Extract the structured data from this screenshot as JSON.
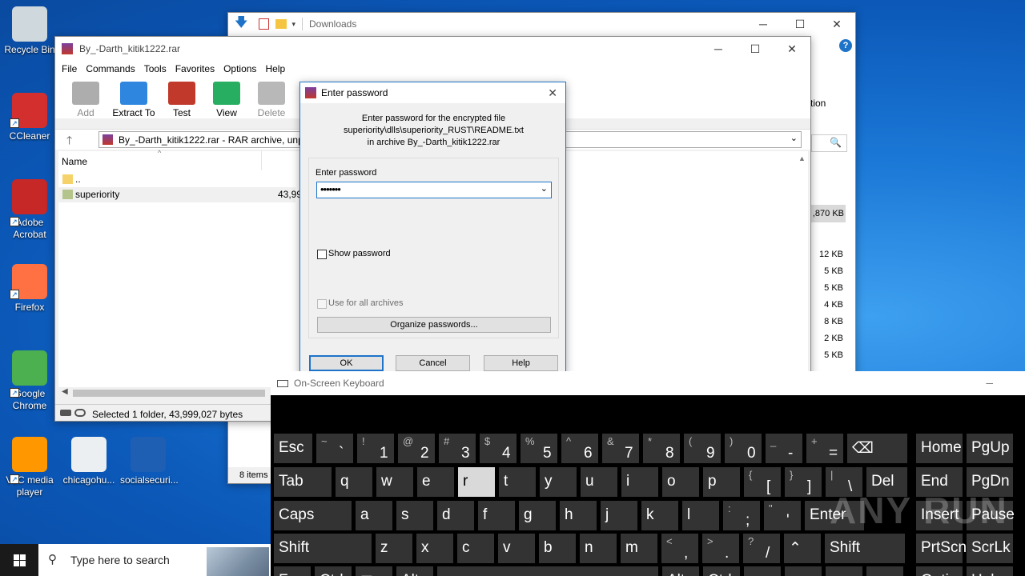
{
  "desktop": {
    "icons": [
      {
        "label": "Recycle Bin",
        "color": "#cfd8dc"
      },
      {
        "label": "CCleaner",
        "color": "#d32f2f"
      },
      {
        "label": "Adobe Acrobat",
        "color": "#c62828"
      },
      {
        "label": "Firefox",
        "color": "#ff7043"
      },
      {
        "label": "Google Chrome",
        "color": "#4caf50"
      },
      {
        "label": "VLC media player",
        "color": "#ff9800"
      },
      {
        "label": "chicagohu...",
        "color": "#eceff1"
      },
      {
        "label": "socialsecuri...",
        "color": "#1e5fb4"
      }
    ]
  },
  "explorer": {
    "title": "Downloads",
    "partial_label": "tion",
    "size_selected": ",870 KB",
    "sizes": [
      "12 KB",
      "5 KB",
      "5 KB",
      "4 KB",
      "8 KB",
      "2 KB",
      "5 KB"
    ],
    "items_count": "8 items"
  },
  "winrar": {
    "title": "By_-Darth_kitik1222.rar",
    "menu": [
      "File",
      "Commands",
      "Tools",
      "Favorites",
      "Options",
      "Help"
    ],
    "toolbar": [
      {
        "label": "Add",
        "icon": "add-archive-icon",
        "disabled": true
      },
      {
        "label": "Extract To",
        "icon": "extract-folder-icon",
        "disabled": false
      },
      {
        "label": "Test",
        "icon": "test-clipboard-icon",
        "disabled": false
      },
      {
        "label": "View",
        "icon": "view-book-icon",
        "disabled": false
      },
      {
        "label": "Delete",
        "icon": "trash-icon",
        "disabled": true
      }
    ],
    "address": "By_-Darth_kitik1222.rar - RAR archive, unpa",
    "column_name": "Name",
    "files": [
      {
        "name": "..",
        "size": ""
      },
      {
        "name": "superiority",
        "size": "43,99"
      }
    ],
    "status": "Selected 1 folder, 43,999,027 bytes"
  },
  "dialog": {
    "title": "Enter password",
    "msg1": "Enter password for the encrypted file",
    "msg2": "superiority\\dlls\\superiority_RUST\\README.txt",
    "msg3": "in archive By_-Darth_kitik1222.rar",
    "label": "Enter password",
    "value": "•••••••",
    "show_password": "Show password",
    "use_for_all": "Use for all archives",
    "organize": "Organize passwords...",
    "ok": "OK",
    "cancel": "Cancel",
    "help": "Help"
  },
  "osk": {
    "title": "On-Screen Keyboard",
    "rows": [
      [
        {
          "t": "Esc",
          "w": 48
        },
        {
          "s": "~",
          "m": "`",
          "w": 46
        },
        {
          "s": "!",
          "m": "1",
          "w": 46
        },
        {
          "s": "@",
          "m": "2",
          "w": 46
        },
        {
          "s": "#",
          "m": "3",
          "w": 46
        },
        {
          "s": "$",
          "m": "4",
          "w": 46
        },
        {
          "s": "%",
          "m": "5",
          "w": 46
        },
        {
          "s": "^",
          "m": "6",
          "w": 46
        },
        {
          "s": "&",
          "m": "7",
          "w": 46
        },
        {
          "s": "*",
          "m": "8",
          "w": 46
        },
        {
          "s": "(",
          "m": "9",
          "w": 46
        },
        {
          "s": ")",
          "m": "0",
          "w": 46
        },
        {
          "s": "_",
          "m": "-",
          "w": 46
        },
        {
          "s": "+",
          "m": "=",
          "w": 46
        },
        {
          "t": "⌫",
          "w": 75
        },
        {
          "t": "Home",
          "w": 58
        },
        {
          "t": "PgUp",
          "w": 58
        }
      ],
      [
        {
          "t": "Tab",
          "w": 72
        },
        {
          "t": "q",
          "w": 46
        },
        {
          "t": "w",
          "w": 46
        },
        {
          "t": "e",
          "w": 46
        },
        {
          "t": "r",
          "w": 46,
          "hi": true
        },
        {
          "t": "t",
          "w": 46
        },
        {
          "t": "y",
          "w": 46
        },
        {
          "t": "u",
          "w": 46
        },
        {
          "t": "i",
          "w": 46
        },
        {
          "t": "o",
          "w": 46
        },
        {
          "t": "p",
          "w": 46
        },
        {
          "s": "{",
          "m": "[",
          "w": 46
        },
        {
          "s": "}",
          "m": "]",
          "w": 46
        },
        {
          "s": "|",
          "m": "\\",
          "w": 46
        },
        {
          "t": "Del",
          "w": 51
        },
        {
          "t": "End",
          "w": 58
        },
        {
          "t": "PgDn",
          "w": 58
        }
      ],
      [
        {
          "t": "Caps",
          "w": 97
        },
        {
          "t": "a",
          "w": 46
        },
        {
          "t": "s",
          "w": 46
        },
        {
          "t": "d",
          "w": 46
        },
        {
          "t": "f",
          "w": 46
        },
        {
          "t": "g",
          "w": 46
        },
        {
          "t": "h",
          "w": 46
        },
        {
          "t": "j",
          "w": 46
        },
        {
          "t": "k",
          "w": 46
        },
        {
          "t": "l",
          "w": 46
        },
        {
          "s": ":",
          "m": ";",
          "w": 46
        },
        {
          "s": "\"",
          "m": "'",
          "w": 46
        },
        {
          "t": "Enter",
          "w": 74
        },
        {
          "t": "Insert",
          "w": 58
        },
        {
          "t": "Pause",
          "w": 58
        }
      ],
      [
        {
          "t": "Shift",
          "w": 122
        },
        {
          "t": "z",
          "w": 46
        },
        {
          "t": "x",
          "w": 46
        },
        {
          "t": "c",
          "w": 46
        },
        {
          "t": "v",
          "w": 46
        },
        {
          "t": "b",
          "w": 46
        },
        {
          "t": "n",
          "w": 46
        },
        {
          "t": "m",
          "w": 46
        },
        {
          "s": "<",
          "m": ",",
          "w": 46
        },
        {
          "s": ">",
          "m": ".",
          "w": 46
        },
        {
          "s": "?",
          "m": "/",
          "w": 46
        },
        {
          "t": "⌃",
          "w": 46
        },
        {
          "t": "Shift",
          "w": 100
        },
        {
          "t": "PrtScn",
          "w": 58
        },
        {
          "t": "ScrLk",
          "w": 58
        }
      ],
      [
        {
          "t": "Fn",
          "w": 46
        },
        {
          "t": "Ctrl",
          "w": 46
        },
        {
          "t": "⊞",
          "w": 46
        },
        {
          "t": "Alt",
          "w": 46
        },
        {
          "t": " ",
          "w": 276
        },
        {
          "t": "Alt",
          "w": 46
        },
        {
          "t": "Ctrl",
          "w": 46
        },
        {
          "t": "‹",
          "w": 46
        },
        {
          "t": "⌄",
          "w": 46
        },
        {
          "t": "›",
          "w": 46
        },
        {
          "t": "≡",
          "w": 46
        },
        {
          "t": "Options",
          "w": 58
        },
        {
          "t": "Help",
          "w": 58
        }
      ]
    ]
  },
  "taskbar": {
    "search_placeholder": "Type here to search"
  },
  "watermark": "ANY RUN"
}
